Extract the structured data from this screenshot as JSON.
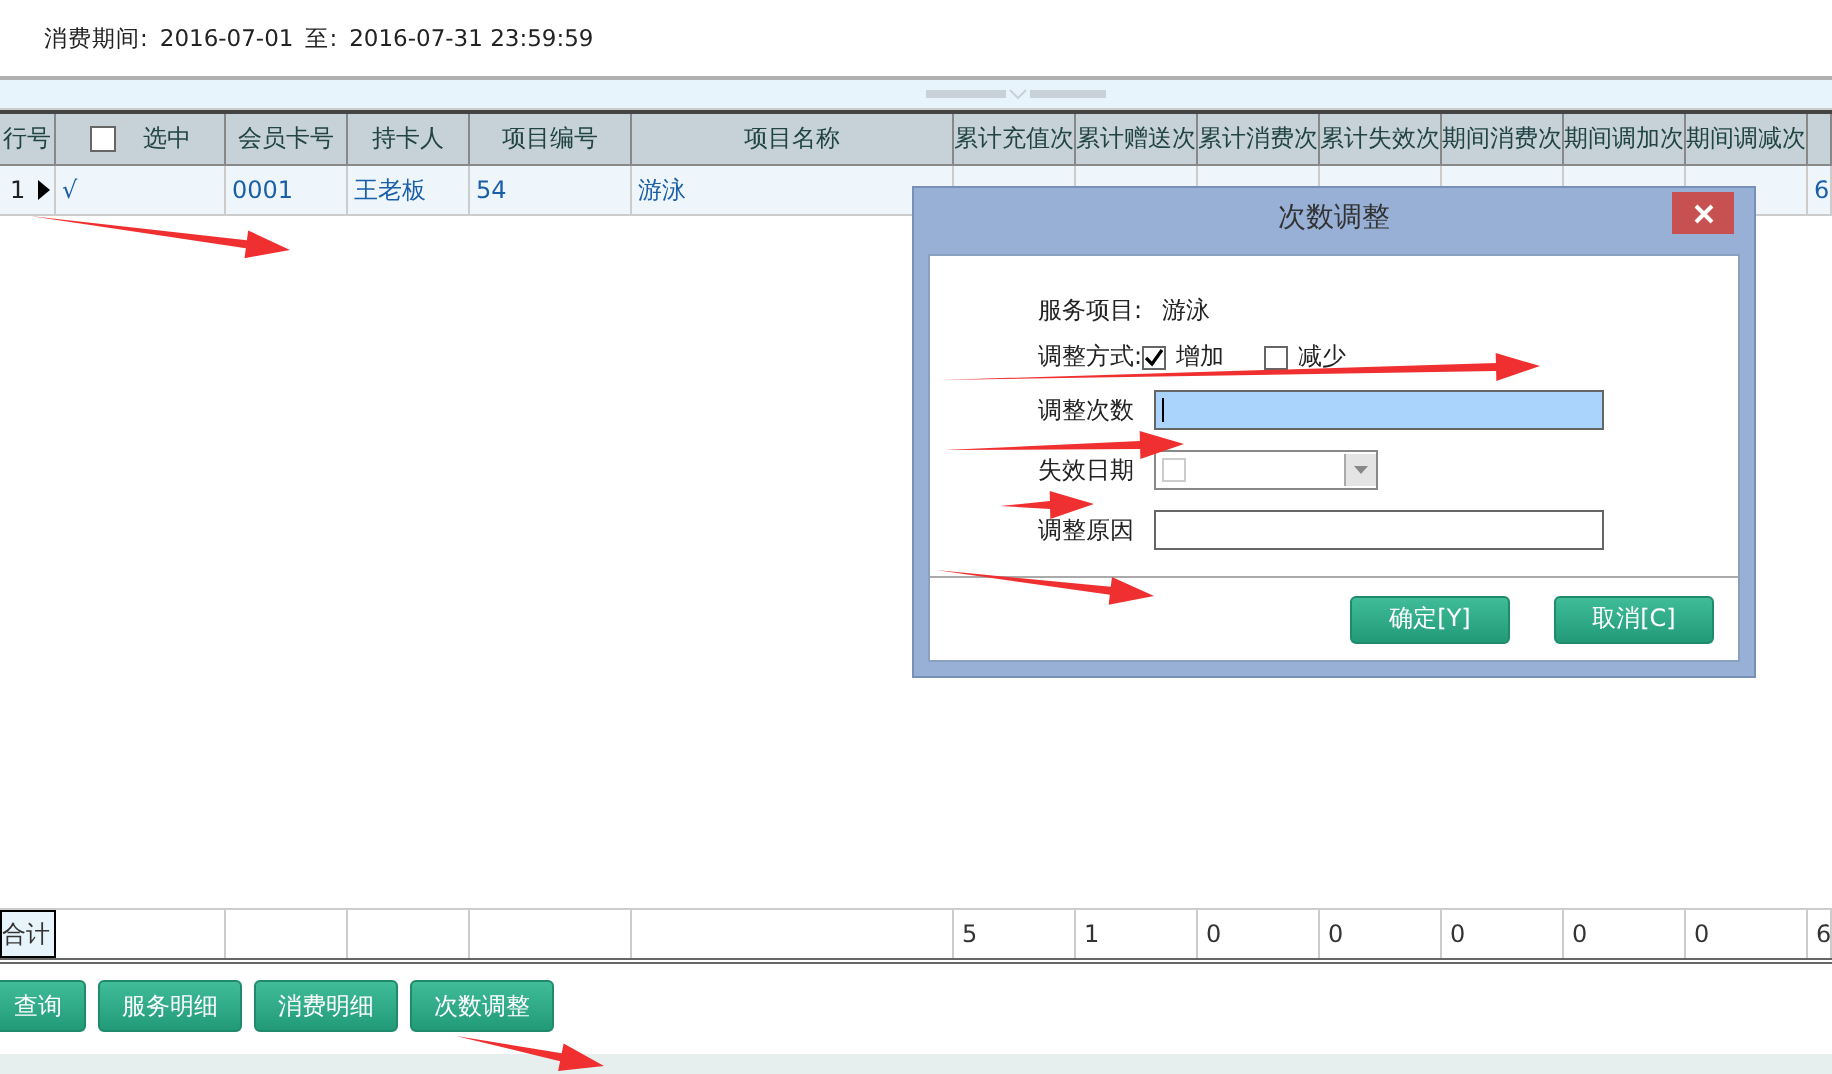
{
  "period": {
    "label": "消费期间:",
    "start": "2016-07-01",
    "to": "至:",
    "end": "2016-07-31 23:59:59"
  },
  "table": {
    "select_all_checked": false,
    "columns": [
      "行号",
      "选中",
      "会员卡号",
      "持卡人",
      "项目编号",
      "项目名称",
      "累计充值次",
      "累计赠送次",
      "累计消费次",
      "累计失效次",
      "期间消费次",
      "期间调加次",
      "期间调减次",
      ""
    ],
    "rows": [
      {
        "current": true,
        "cells": [
          "1",
          "√",
          "0001",
          "王老板",
          "54",
          "游泳",
          "",
          "",
          "",
          "",
          "",
          "",
          "",
          "6"
        ]
      }
    ],
    "totals": {
      "cells": [
        "合计",
        "",
        "",
        "",
        "",
        "",
        "5",
        "1",
        "0",
        "0",
        "0",
        "0",
        "0",
        "6"
      ]
    }
  },
  "dialog": {
    "title": "次数调整",
    "service_label": "服务项目:",
    "service_value": "游泳",
    "mode_label": "调整方式:",
    "options": [
      {
        "label": "增加",
        "checked": true
      },
      {
        "label": "减少",
        "checked": false
      }
    ],
    "fields": [
      {
        "kind": "text",
        "label": "调整次数",
        "focused": true
      },
      {
        "kind": "date",
        "label": "失效日期",
        "focused": false
      },
      {
        "kind": "text",
        "label": "调整原因",
        "focused": false
      }
    ],
    "buttons": [
      "确定[Y]",
      "取消[C]"
    ]
  },
  "buttons": [
    "查询",
    "服务明细",
    "消费明细",
    "次数调整"
  ]
}
